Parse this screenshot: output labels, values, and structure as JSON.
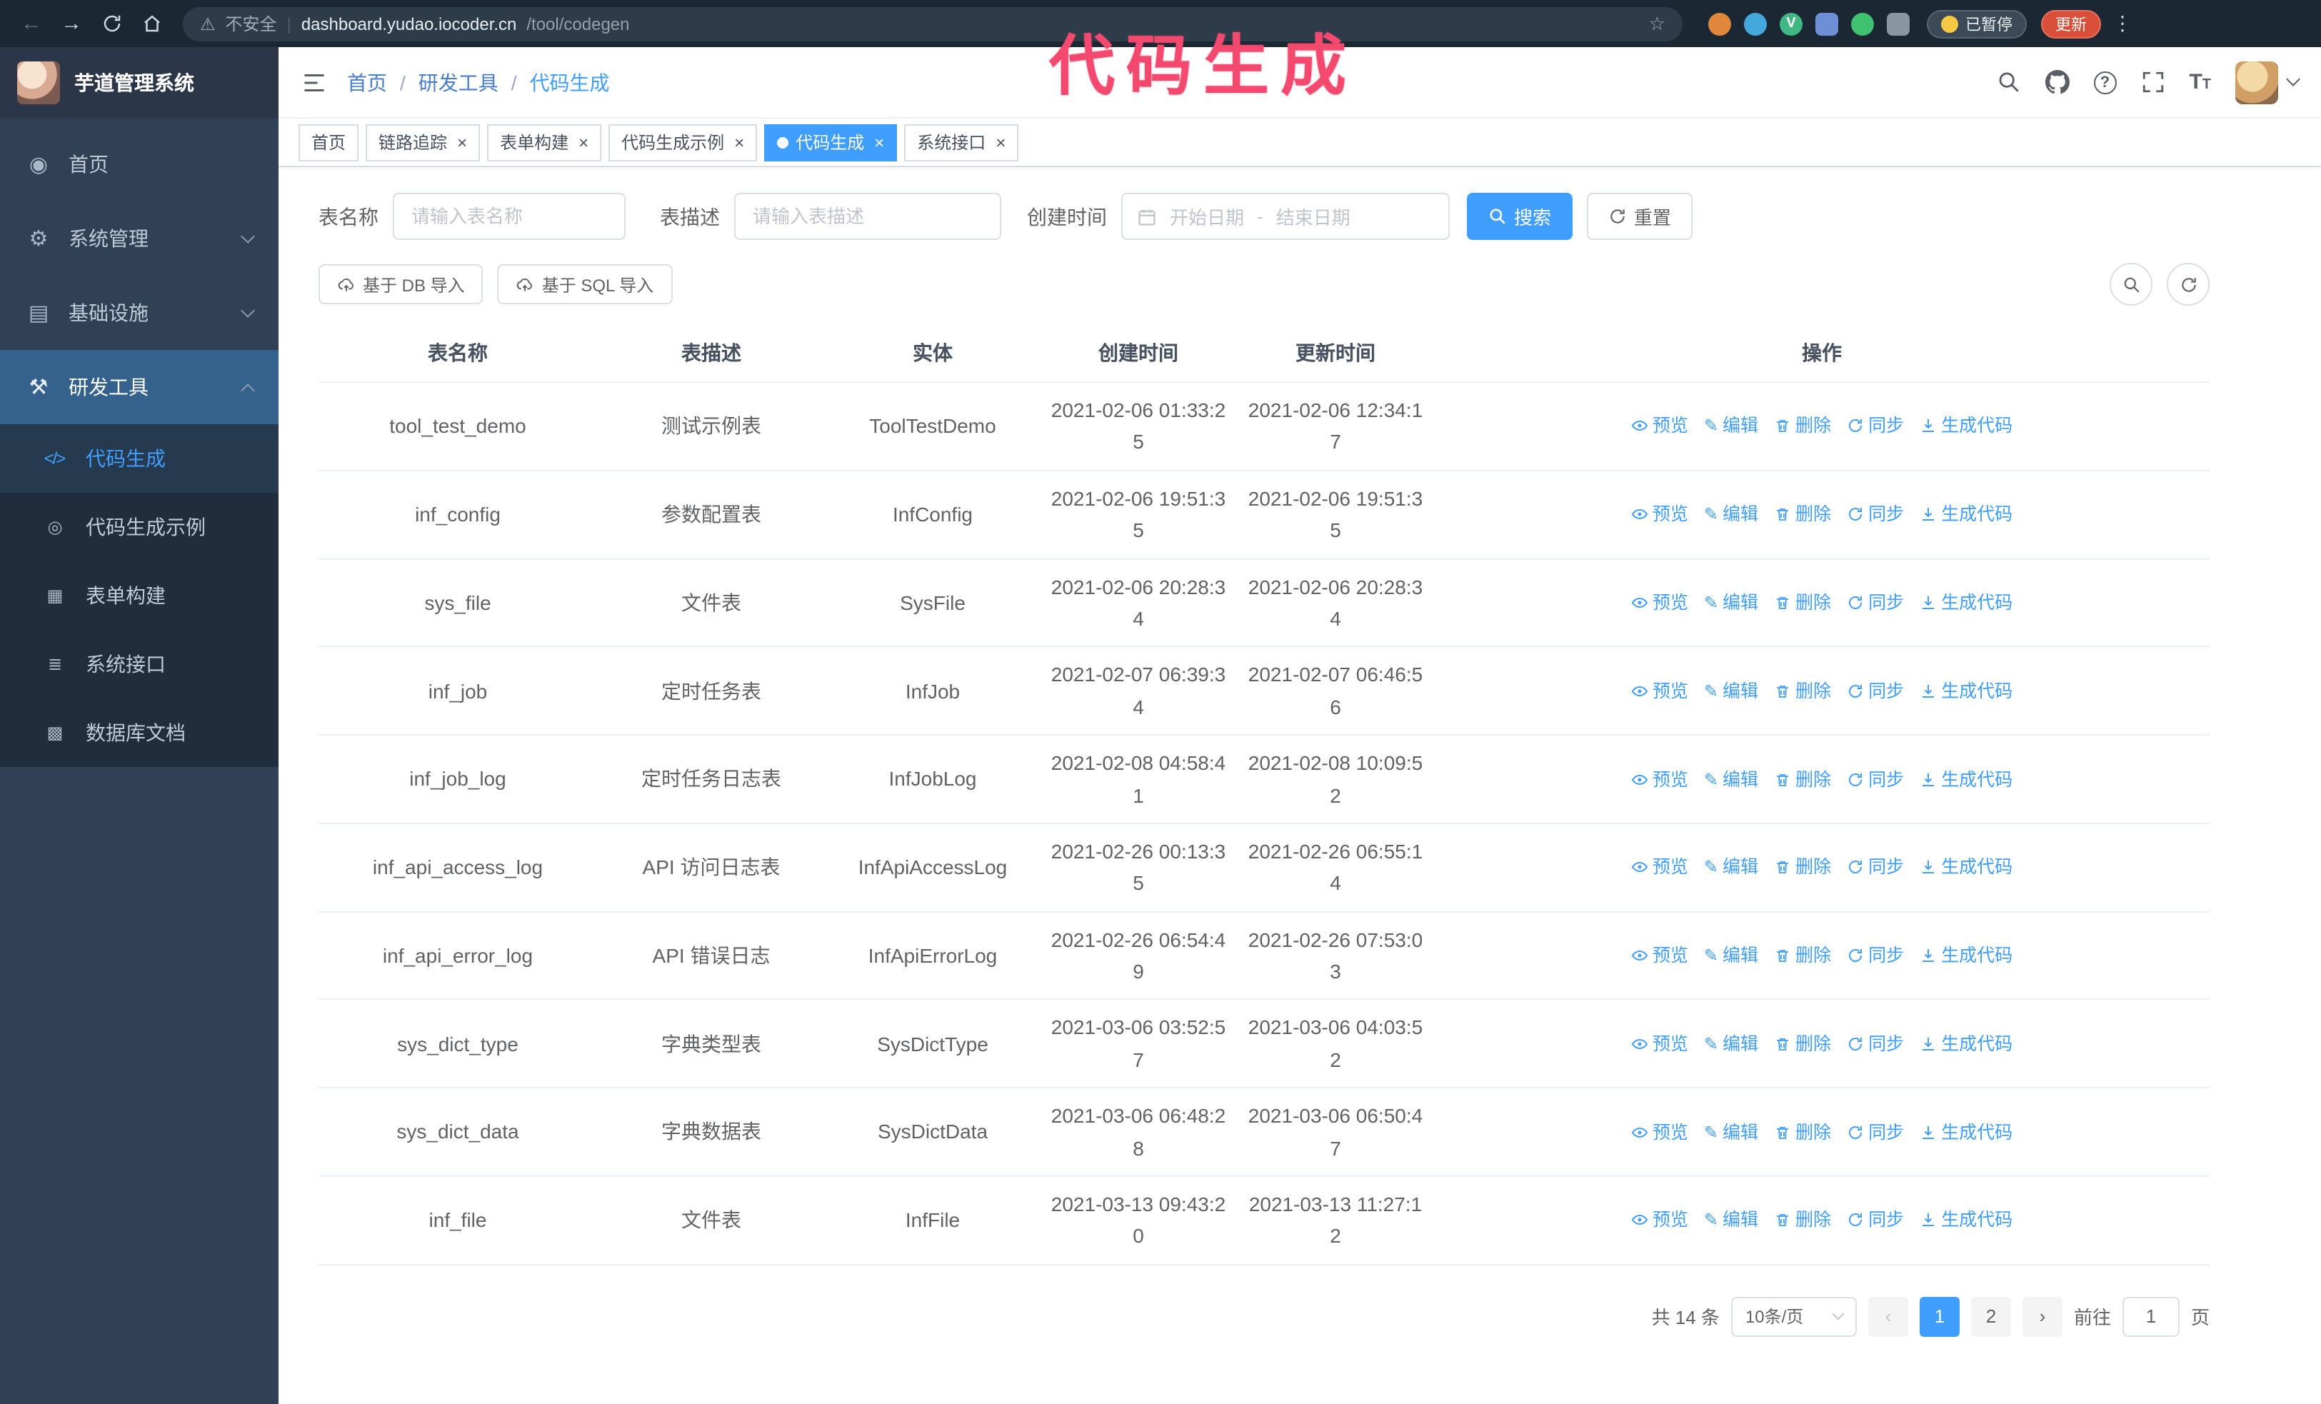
{
  "annotation": {
    "text": "代码生成"
  },
  "colors": {
    "accent": "#409eff",
    "annotation": "#f4496f",
    "sidebar_bg": "#304156",
    "chrome_bg": "#1b2733",
    "update_button": "#d94f3a"
  },
  "browser": {
    "security": "不安全",
    "url_host": "dashboard.yudao.iocoder.cn",
    "url_path": "/tool/codegen",
    "paused_badge": "已暂停",
    "update_button": "更新"
  },
  "sidebar": {
    "logo_title": "芋道管理系统",
    "items": [
      {
        "label": "首页"
      },
      {
        "label": "系统管理"
      },
      {
        "label": "基础设施"
      },
      {
        "label": "研发工具"
      }
    ],
    "sub_items": [
      {
        "label": "代码生成"
      },
      {
        "label": "代码生成示例"
      },
      {
        "label": "表单构建"
      },
      {
        "label": "系统接口"
      },
      {
        "label": "数据库文档"
      }
    ]
  },
  "breadcrumb": {
    "items": [
      "首页",
      "研发工具",
      "代码生成"
    ],
    "separator": "/"
  },
  "tabs": [
    {
      "label": "首页"
    },
    {
      "label": "链路追踪"
    },
    {
      "label": "表单构建"
    },
    {
      "label": "代码生成示例"
    },
    {
      "label": "代码生成"
    },
    {
      "label": "系统接口"
    }
  ],
  "filters": {
    "table_name_label": "表名称",
    "table_name_placeholder": "请输入表名称",
    "table_desc_label": "表描述",
    "table_desc_placeholder": "请输入表描述",
    "create_time_label": "创建时间",
    "date_start_placeholder": "开始日期",
    "date_separator": "-",
    "date_end_placeholder": "结束日期",
    "search_button": "搜索",
    "reset_button": "重置"
  },
  "toolbar": {
    "db_import_button": "基于 DB 导入",
    "sql_import_button": "基于 SQL 导入"
  },
  "table": {
    "headers": [
      "表名称",
      "表描述",
      "实体",
      "创建时间",
      "更新时间",
      "操作"
    ],
    "actions": [
      "预览",
      "编辑",
      "删除",
      "同步",
      "生成代码"
    ],
    "rows": [
      {
        "name": "tool_test_demo",
        "desc": "测试示例表",
        "entity": "ToolTestDemo",
        "create_time": "2021-02-06 01:33:25",
        "update_time": "2021-02-06 12:34:17"
      },
      {
        "name": "inf_config",
        "desc": "参数配置表",
        "entity": "InfConfig",
        "create_time": "2021-02-06 19:51:35",
        "update_time": "2021-02-06 19:51:35"
      },
      {
        "name": "sys_file",
        "desc": "文件表",
        "entity": "SysFile",
        "create_time": "2021-02-06 20:28:34",
        "update_time": "2021-02-06 20:28:34"
      },
      {
        "name": "inf_job",
        "desc": "定时任务表",
        "entity": "InfJob",
        "create_time": "2021-02-07 06:39:34",
        "update_time": "2021-02-07 06:46:56"
      },
      {
        "name": "inf_job_log",
        "desc": "定时任务日志表",
        "entity": "InfJobLog",
        "create_time": "2021-02-08 04:58:41",
        "update_time": "2021-02-08 10:09:52"
      },
      {
        "name": "inf_api_access_log",
        "desc": "API 访问日志表",
        "entity": "InfApiAccessLog",
        "create_time": "2021-02-26 00:13:35",
        "update_time": "2021-02-26 06:55:14"
      },
      {
        "name": "inf_api_error_log",
        "desc": "API 错误日志",
        "entity": "InfApiErrorLog",
        "create_time": "2021-02-26 06:54:49",
        "update_time": "2021-02-26 07:53:03"
      },
      {
        "name": "sys_dict_type",
        "desc": "字典类型表",
        "entity": "SysDictType",
        "create_time": "2021-03-06 03:52:57",
        "update_time": "2021-03-06 04:03:52"
      },
      {
        "name": "sys_dict_data",
        "desc": "字典数据表",
        "entity": "SysDictData",
        "create_time": "2021-03-06 06:48:28",
        "update_time": "2021-03-06 06:50:47"
      },
      {
        "name": "inf_file",
        "desc": "文件表",
        "entity": "InfFile",
        "create_time": "2021-03-13 09:43:20",
        "update_time": "2021-03-13 11:27:12"
      }
    ]
  },
  "pagination": {
    "total": "共 14 条",
    "page_size": "10条/页",
    "pages": [
      "1",
      "2"
    ],
    "active_page": "1",
    "goto_label": "前往",
    "goto_value": "1",
    "goto_suffix": "页"
  },
  "icons": {
    "back": "←",
    "forward": "→",
    "warning": "⚠",
    "star": "☆",
    "close": "×",
    "question": "?",
    "font_large": "T",
    "font_small": "T",
    "dots": "⋮",
    "vue": "V",
    "dashboard": "◉",
    "gear": "⚙",
    "infra": "▤",
    "tools": "⚒",
    "code": "</>",
    "example": "◎",
    "form": "▦",
    "api": "≣",
    "db": "▩",
    "pencil": "✎",
    "prev": "‹",
    "next": "›"
  }
}
